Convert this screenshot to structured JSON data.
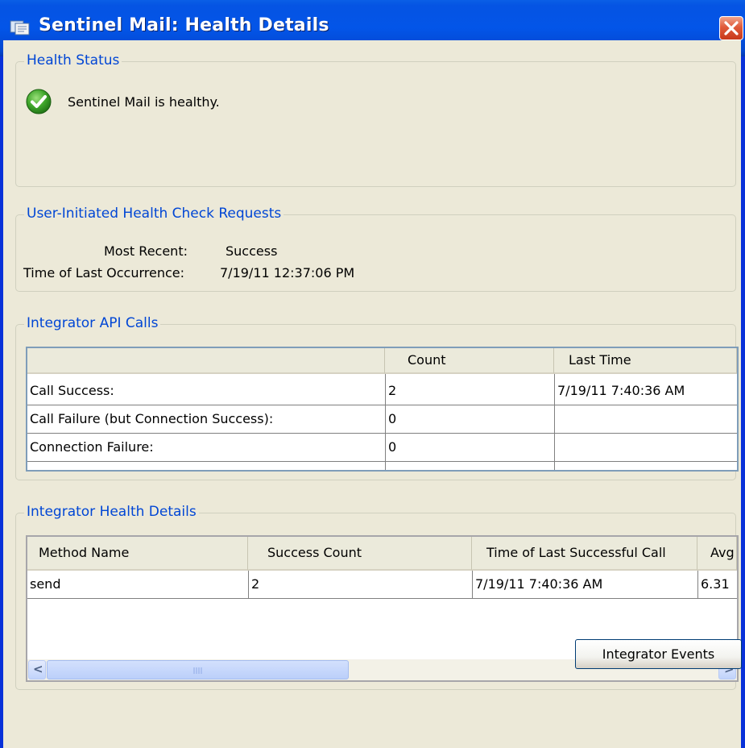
{
  "window": {
    "title": "Sentinel Mail: Health Details"
  },
  "health_status": {
    "legend": "Health Status",
    "message": "Sentinel Mail is healthy."
  },
  "user_checks": {
    "legend": "User-Initiated Health Check Requests",
    "most_recent_label": "Most Recent:",
    "most_recent_value": "Success",
    "last_occurrence_label": "Time of Last Occurrence:",
    "last_occurrence_value": "7/19/11 12:37:06 PM"
  },
  "api_calls": {
    "legend": "Integrator API Calls",
    "columns": [
      "",
      "Count",
      "Last Time"
    ],
    "rows": [
      [
        "Call Success:",
        "2",
        "7/19/11 7:40:36 AM"
      ],
      [
        "Call Failure (but Connection Success):",
        "0",
        ""
      ],
      [
        "Connection Failure:",
        "0",
        ""
      ]
    ]
  },
  "health_details": {
    "legend": "Integrator Health Details",
    "columns": [
      "Method Name",
      "Success Count",
      "Time of Last Successful Call",
      "Avg"
    ],
    "rows": [
      [
        "send",
        "2",
        "7/19/11 7:40:36 AM",
        "6.31"
      ]
    ],
    "scroll_left_glyph": "<",
    "scroll_right_glyph": ">"
  },
  "buttons": {
    "integrator_events": "Integrator Events"
  },
  "colors": {
    "legend": "#0046d5",
    "titlebar": "#0355e8",
    "dialog_bg": "#ece9d8",
    "close": "#e05a3a"
  }
}
